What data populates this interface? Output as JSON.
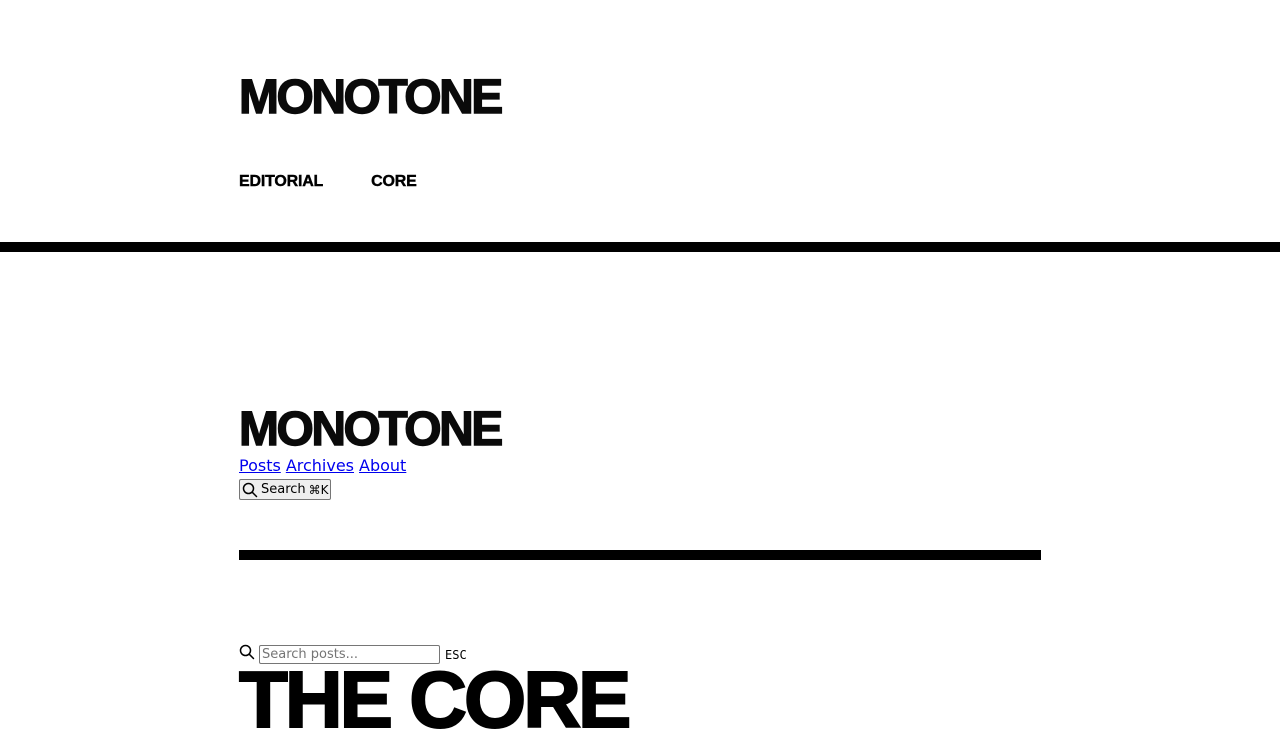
{
  "site": {
    "brand": "MONOTONE"
  },
  "top_nav": {
    "items": [
      {
        "label": "EDITORIAL"
      },
      {
        "label": "CORE"
      }
    ]
  },
  "header": {
    "brand": "MONOTONE",
    "links": [
      {
        "label": "Posts"
      },
      {
        "label": "Archives"
      },
      {
        "label": "About"
      }
    ],
    "search_button": {
      "label": "Search",
      "shortcut": "⌘K",
      "icon": "search-icon"
    }
  },
  "search": {
    "placeholder": "Search posts...",
    "value": "",
    "close_hint": "ESC",
    "icon": "search-icon"
  },
  "main": {
    "title": "THE CORE"
  },
  "colors": {
    "background": "#ffffff",
    "foreground": "#000000",
    "link": "#0000ee"
  }
}
